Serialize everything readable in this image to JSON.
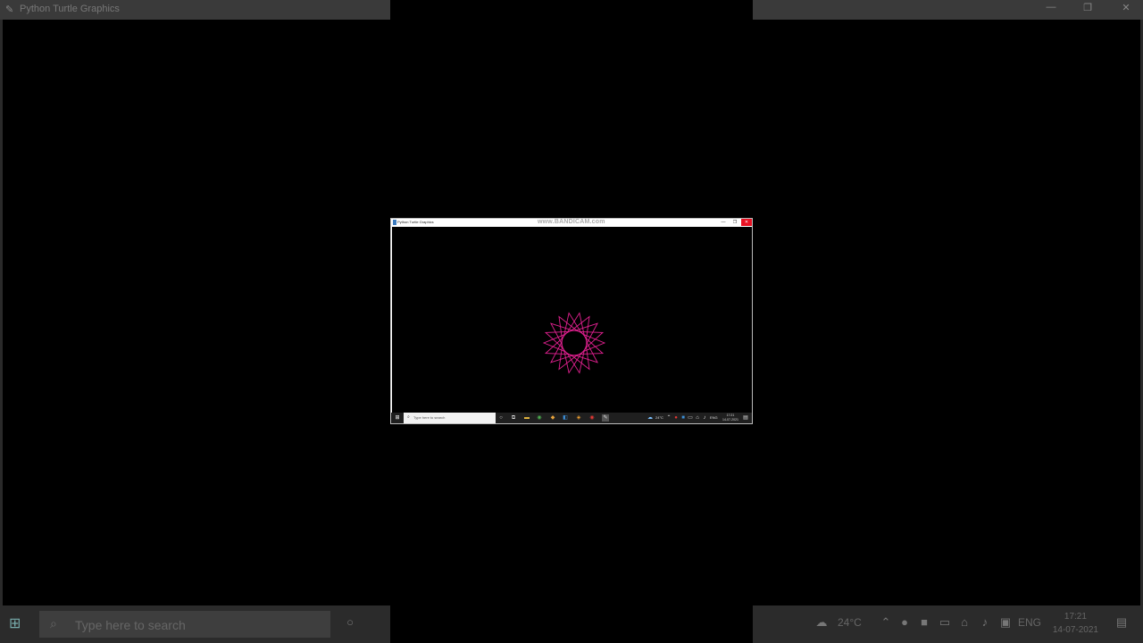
{
  "background": {
    "title": "Python Turtle Graphics",
    "window_controls": [
      "—",
      "❐",
      "✕"
    ],
    "search_placeholder": "Type here to search",
    "temperature": "24°C",
    "language": "ENG",
    "time": "17:21",
    "date": "14-07-2021"
  },
  "window": {
    "title": "Python Turtle Graphics",
    "watermark": "www.BANDICAM.com",
    "controls": {
      "minimize": "—",
      "maximize": "❐",
      "close": "✕"
    }
  },
  "taskbar": {
    "search_placeholder": "Type here to search",
    "temperature": "24°C",
    "language": "ENG",
    "time": "17:21",
    "date": "14-07-2021"
  },
  "drawing": {
    "pen_color": "#e0208f",
    "background_color": "#000000"
  }
}
